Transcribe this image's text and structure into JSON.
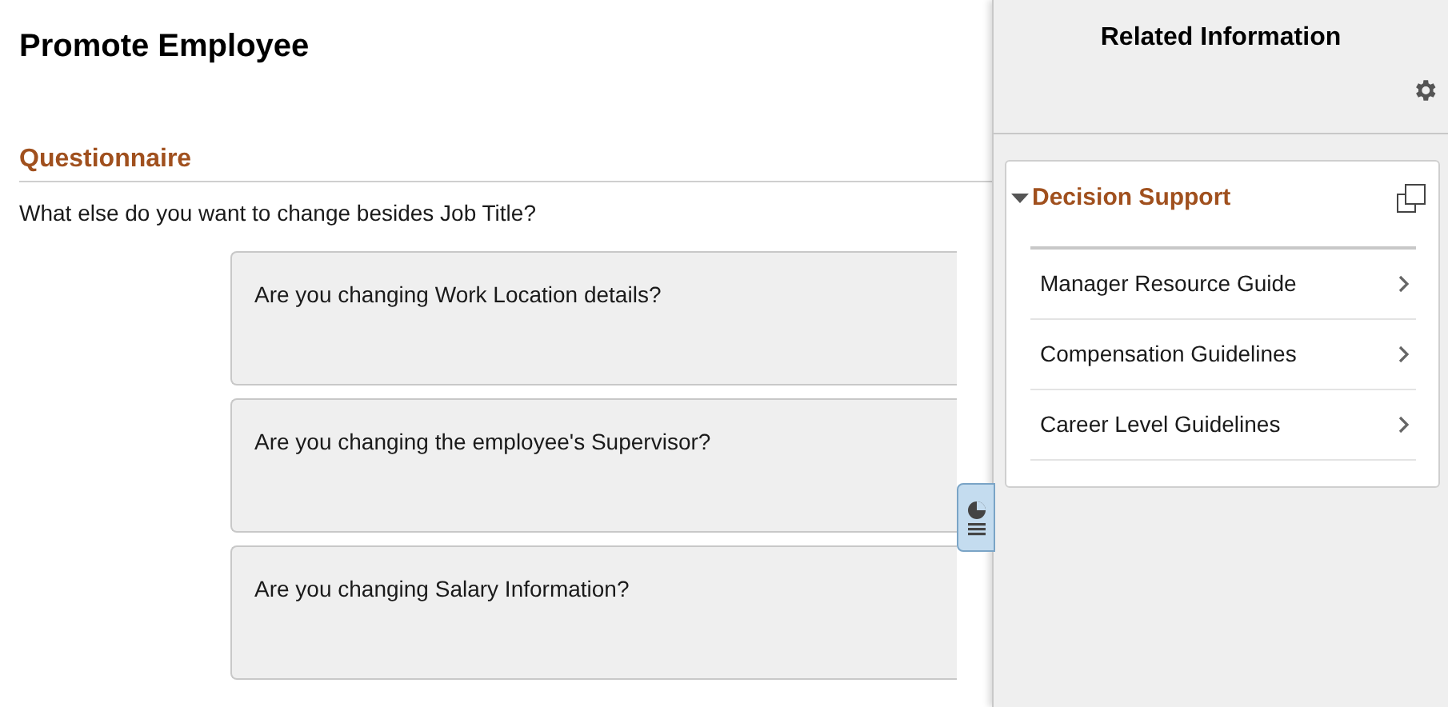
{
  "page": {
    "title": "Promote Employee"
  },
  "questionnaire": {
    "heading": "Questionnaire",
    "prompt": "What else do you want to change besides Job Title?",
    "questions": [
      "Are you changing Work Location details?",
      "Are you changing the employee's Supervisor?",
      "Are you changing Salary Information?"
    ]
  },
  "related_panel": {
    "title": "Related Information",
    "section": {
      "title": "Decision Support",
      "expanded": true,
      "items": [
        "Manager Resource Guide",
        "Compensation Guidelines",
        "Career Level Guidelines"
      ]
    }
  }
}
